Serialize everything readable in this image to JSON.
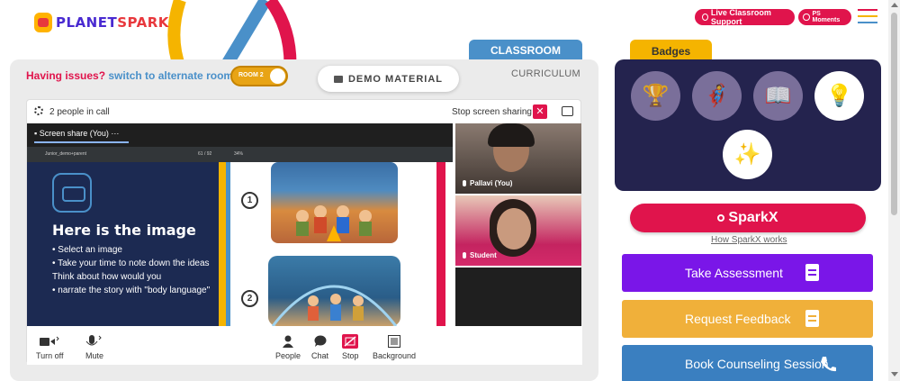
{
  "brand": {
    "name_part1": "PLANET",
    "name_part2": "SPARK"
  },
  "topbar": {
    "live_support_label": "Live Classroom Support",
    "ps_moments_label": "PS Moments"
  },
  "tabs": {
    "classroom": "CLASSROOM",
    "curriculum": "CURRICULUM"
  },
  "issues": {
    "prefix": "Having issues?",
    "link": "switch to alternate room"
  },
  "room_toggle": {
    "label": "ROOM 2"
  },
  "demo_material": {
    "label": "DEMO MATERIAL",
    "icon": "folder-icon"
  },
  "call": {
    "people_count": "2 people in call",
    "stop_sharing": "Stop screen sharing",
    "share_tab": "Screen share (You)",
    "pdf_title": "Junior_demo+parent",
    "pdf_page": "61 / 92",
    "pdf_zoom": "34%",
    "slide": {
      "title": "Here is the image",
      "bullets": [
        "• Select an image",
        "• Take your time to note down the ideas",
        "Think about how would you",
        "• narrate the story with \"body language\""
      ],
      "num1": "1",
      "num2": "2"
    },
    "participants": [
      {
        "name": "Pallavi (You)"
      },
      {
        "name": "Student"
      }
    ],
    "controls": {
      "turn_off": "Turn off",
      "mute": "Mute",
      "people": "People",
      "chat": "Chat",
      "stop": "Stop",
      "background": "Background"
    }
  },
  "badges": {
    "title": "Badges",
    "items": [
      "trophy-badge",
      "hero-badge",
      "reading-badge",
      "idea-badge",
      "spark-badge"
    ]
  },
  "sparkx": {
    "label": "SparkX",
    "how": "How SparkX works"
  },
  "actions": {
    "take_assessment": "Take Assessment",
    "request_feedback": "Request Feedback",
    "book_counseling": "Book Counseling Session"
  },
  "colors": {
    "primary_red": "#e0144c",
    "blue": "#4a90c9",
    "purple": "#7a16e8",
    "orange": "#f0b03a",
    "navy": "#24234e"
  }
}
